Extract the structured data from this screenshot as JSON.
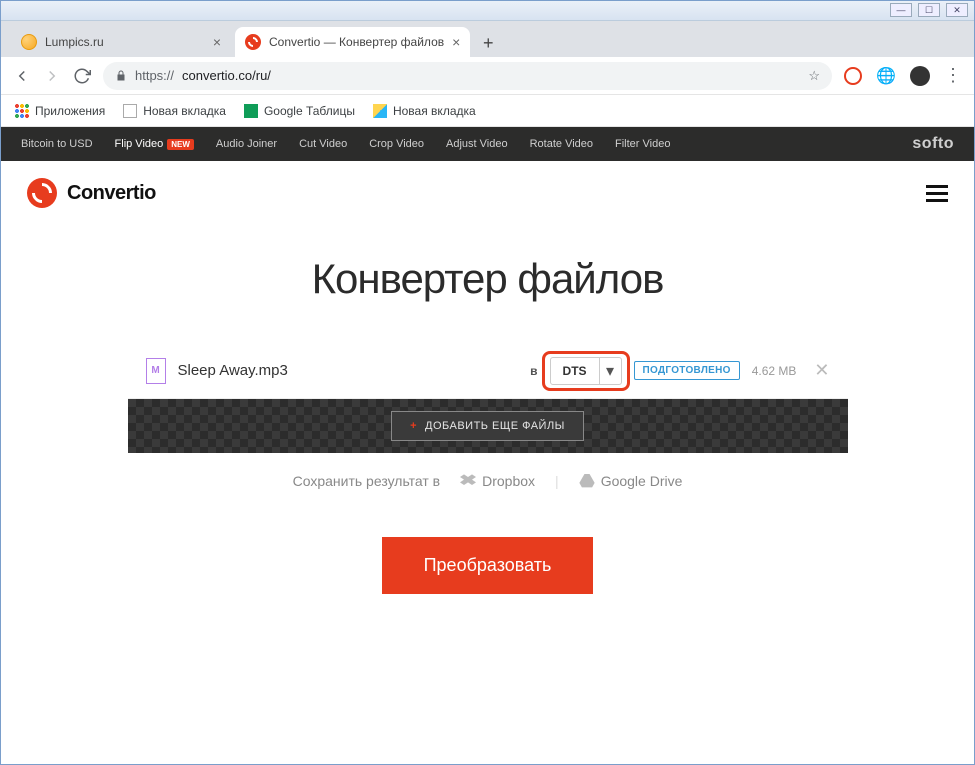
{
  "browser": {
    "tabs": [
      {
        "title": "Lumpics.ru"
      },
      {
        "title": "Convertio — Конвертер файлов"
      }
    ],
    "url_scheme": "https://",
    "url_rest": "convertio.co/ru/",
    "bookmarks": [
      "Приложения",
      "Новая вкладка",
      "Google Таблицы",
      "Новая вкладка"
    ]
  },
  "topnav": {
    "items": [
      "Bitcoin to USD",
      "Flip Video",
      "Audio Joiner",
      "Cut Video",
      "Crop Video",
      "Adjust Video",
      "Rotate Video",
      "Filter Video"
    ],
    "new_badge": "NEW",
    "brand": "softo"
  },
  "header": {
    "logo": "Convertio"
  },
  "main": {
    "heading": "Конвертер файлов",
    "add_more_label": "ДОБАВИТЬ ЕЩЕ ФАЙЛЫ",
    "save_to_label": "Сохранить результат в",
    "save_options": [
      "Dropbox",
      "Google Drive"
    ],
    "convert_label": "Преобразовать"
  },
  "file": {
    "icon_letter": "M",
    "name": "Sleep Away.mp3",
    "to_label": "в",
    "target_format": "DTS",
    "status": "ПОДГОТОВЛЕНО",
    "size": "4.62 MB"
  },
  "colors": {
    "accent": "#e73c1e",
    "link": "#3597d3"
  }
}
